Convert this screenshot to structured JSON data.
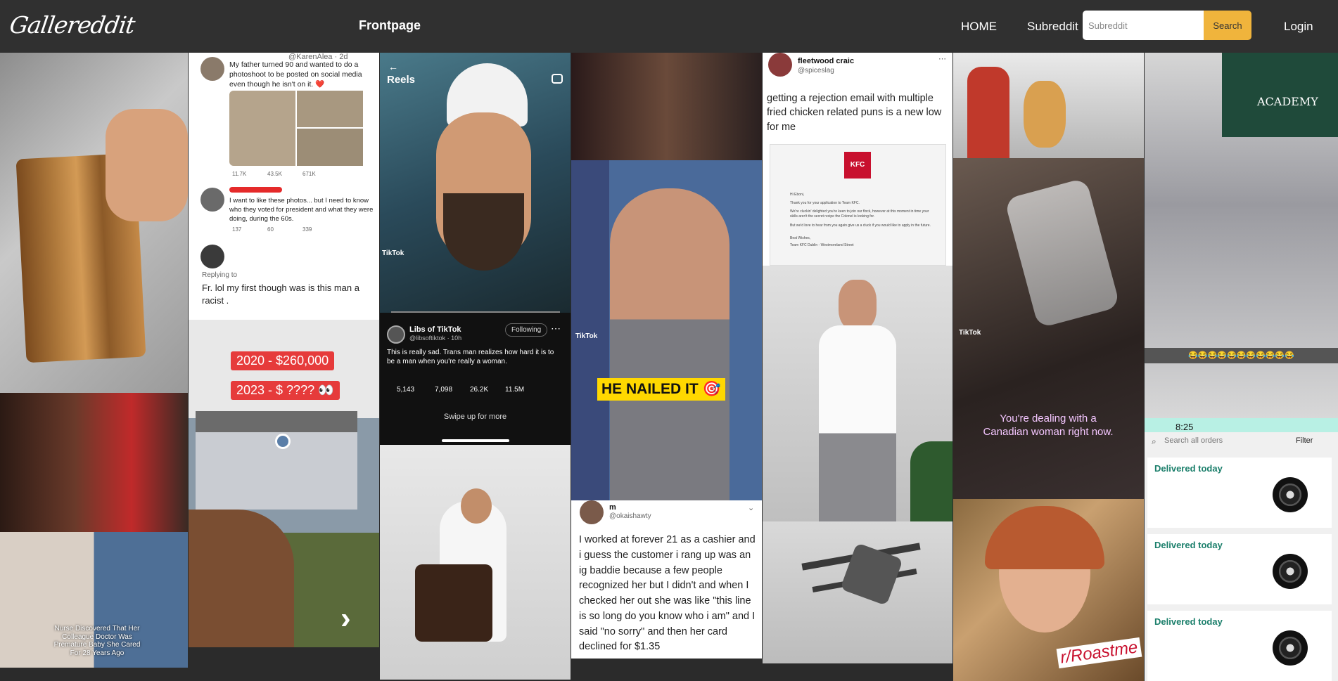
{
  "navbar": {
    "logo": "Gallereddit",
    "title": "Frontpage",
    "home": "HOME",
    "subreddit": "Subreddit",
    "search_placeholder": "Subreddit",
    "search_button": "Search",
    "login": "Login"
  },
  "posts": {
    "tweet1": {
      "handle": "@KarenAlea · 2d",
      "text": "My father turned 90 and wanted to do a photoshoot to be posted on social media even though he isn't on it. ❤️",
      "replies": "11.7K",
      "retweets": "43.5K",
      "likes": "671K",
      "reply_text": "I want to like these photos... but I need to know who they voted for president and what they were doing, during the 60s.",
      "reply_replies": "137",
      "reply_retweets": "60",
      "reply_likes": "339",
      "replying_to": "Replying to",
      "third_text": "Fr. lol my first though was is this man a racist ."
    },
    "house": {
      "price1": "2020 - $260,000",
      "price2": "2023 - $ ???? 👀"
    },
    "reels": {
      "header": "Reels",
      "account": "Libs of TikTok",
      "handle": "@libsoftiktok · 10h",
      "following": "Following",
      "caption": "This is really sad. Trans man realizes how hard it is to be a man when you're really a woman.",
      "comments": "5,143",
      "retweets": "7,098",
      "likes": "26.2K",
      "views": "11.5M",
      "swipe": "Swipe up for more",
      "tiktok": "TikTok"
    },
    "nailed": {
      "caption": "HE NAILED IT 🎯",
      "tiktok": "TikTok"
    },
    "forever21": {
      "name": "m",
      "handle": "@okaishawty",
      "text": "I worked at forever 21 as a cashier and i guess the customer i rang up was an ig baddie because a few people recognized her but I didn't and when I checked her out she was like \"this line is so long do you know who i am\" and I said \"no sorry\" and then her card declined for $1.35"
    },
    "fleetwood": {
      "name": "fleetwood craic",
      "handle": "@spiceslag",
      "text": "getting a rejection email with multiple fried chicken related puns is a new low for me",
      "kfc": "KFC",
      "email_lines": [
        "Hi Eboni,",
        "Thank you for your application to Team KFC.",
        "We're cluckin' delighted you're keen to join our flock, however at this moment in time your skills aren't the secret recipe the Colonel is looking for.",
        "But we'd love to hear from you again give us a cluck if you would like to apply in the future.",
        "Best Wishes,",
        "Team KFC Dublin - Westmoreland Street"
      ]
    },
    "nurse": {
      "caption": "Nurse Discovered That Her Colleague Doctor Was Premature Baby She Cared For 28 Years Ago"
    },
    "canadian": {
      "caption": "You're dealing with a Canadian woman right now.",
      "tiktok": "TikTok"
    },
    "academy": {
      "sign": "ACADEMY",
      "emojis": "😂😂😂😂😂😂😂😂😂😂😂"
    },
    "orders": {
      "time": "8:25",
      "search": "Search all orders",
      "filter": "Filter",
      "items": [
        "Delivered today",
        "Delivered today",
        "Delivered today"
      ]
    },
    "roastme": {
      "sign": "r/Roastme"
    }
  }
}
